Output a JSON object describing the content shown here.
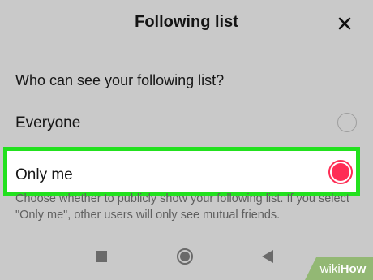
{
  "header": {
    "title": "Following list",
    "close_icon": "close-icon"
  },
  "settings": {
    "question": "Who can see your following list?",
    "options": [
      {
        "label": "Everyone",
        "selected": false
      },
      {
        "label": "Only me",
        "selected": true
      }
    ],
    "description": "Choose whether to publicly show your following list. If you select \"Only me\", other users will only see mutual friends."
  },
  "colors": {
    "accent": "#ff2d55",
    "highlight": "#22e11e",
    "background": "#c9c9c9"
  },
  "navbar": {
    "icons": [
      "recents-square-icon",
      "home-circle-icon",
      "back-triangle-icon"
    ]
  },
  "watermark": {
    "part1": "wiki",
    "part2": "How"
  }
}
